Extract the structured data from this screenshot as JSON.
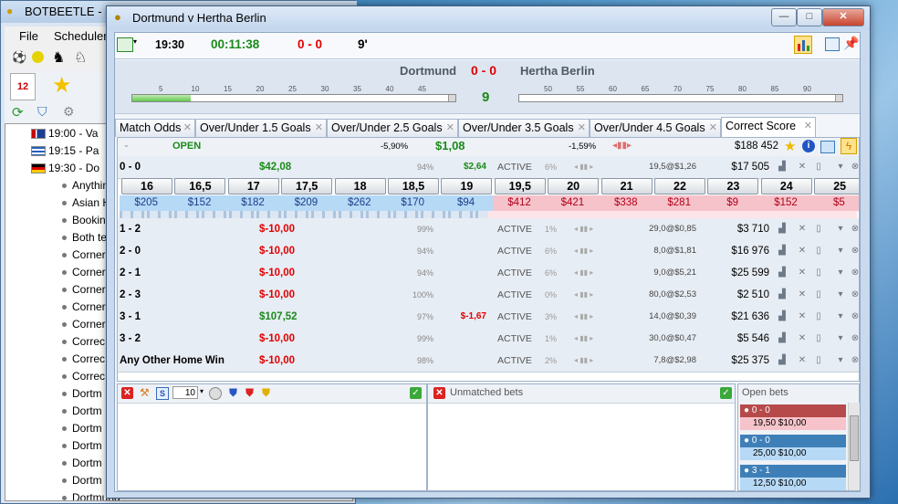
{
  "background_app": {
    "title": "BOTBEETLE - 5.4",
    "menu": [
      "File",
      "Schedulers"
    ],
    "tree_rows": [
      {
        "text": "19:00 - Va",
        "flag": "gb"
      },
      {
        "text": "19:15 - Pa",
        "flag": "gr"
      },
      {
        "text": "19:30 - Do",
        "flag": "de"
      }
    ],
    "tree_items": [
      "Anythin",
      "Asian H",
      "Bookin",
      "Both te",
      "Corner",
      "Corner",
      "Corner",
      "Corner",
      "Corner",
      "Correc",
      "Correc",
      "Correc",
      "Dortm",
      "Dortm",
      "Dortm",
      "Dortm",
      "Dortm",
      "Dortm",
      "Dortmund"
    ]
  },
  "window": {
    "title": "Dortmund v Hertha Berlin",
    "min": "—",
    "max": "□",
    "close": "✕"
  },
  "info_bar": {
    "kickoff": "19:30",
    "elapsed": "00:11:38",
    "score": "0 - 0",
    "minute": "9'"
  },
  "match": {
    "home": "Dortmund",
    "away": "Hertha Berlin",
    "score": "0 - 0",
    "minute": "9",
    "home_progress": 0.18,
    "first_half_ticks": [
      "5",
      "10",
      "15",
      "20",
      "25",
      "30",
      "35",
      "40",
      "45"
    ],
    "second_half_ticks": [
      "50",
      "55",
      "60",
      "65",
      "70",
      "75",
      "80",
      "85",
      "90"
    ]
  },
  "tabs": [
    {
      "label": "Match Odds",
      "active": false
    },
    {
      "label": "Over/Under 1.5 Goals",
      "active": false
    },
    {
      "label": "Over/Under 2.5 Goals",
      "active": false
    },
    {
      "label": "Over/Under 3.5 Goals",
      "active": false
    },
    {
      "label": "Over/Under 4.5 Goals",
      "active": false
    },
    {
      "label": "Correct Score",
      "active": true
    }
  ],
  "market_header": {
    "status": "OPEN",
    "book_pct": "-5,90%",
    "book_value": "$1,08",
    "book_pct2": "-1,59%",
    "matched_total": "$188 452"
  },
  "ladder": {
    "prices": [
      "16",
      "16,5",
      "17",
      "17,5",
      "18",
      "18,5",
      "19",
      "19,5",
      "20",
      "21",
      "22",
      "23",
      "24",
      "25"
    ],
    "amounts": [
      "$205",
      "$152",
      "$182",
      "$209",
      "$262",
      "$170",
      "$94",
      "$412",
      "$421",
      "$338",
      "$281",
      "$9",
      "$152",
      "$5"
    ],
    "back_count": 7
  },
  "selections": [
    {
      "name": "0 - 0",
      "pl": "$42,08",
      "pl_color": "green",
      "pct": "94%",
      "pl2": "$2,64",
      "pl2_color": "green",
      "status": "ACTIVE",
      "spread": "6%",
      "last": "19,5@$1,26",
      "volume": "$17 505"
    },
    {
      "name": "1 - 2",
      "pl": "$-10,00",
      "pl_color": "red",
      "pct": "99%",
      "pl2": "",
      "pl2_color": "",
      "status": "ACTIVE",
      "spread": "1%",
      "last": "29,0@$0,85",
      "volume": "$3 710"
    },
    {
      "name": "2 - 0",
      "pl": "$-10,00",
      "pl_color": "red",
      "pct": "94%",
      "pl2": "",
      "pl2_color": "",
      "status": "ACTIVE",
      "spread": "6%",
      "last": "8,0@$1,81",
      "volume": "$16 976"
    },
    {
      "name": "2 - 1",
      "pl": "$-10,00",
      "pl_color": "red",
      "pct": "94%",
      "pl2": "",
      "pl2_color": "",
      "status": "ACTIVE",
      "spread": "6%",
      "last": "9,0@$5,21",
      "volume": "$25 599"
    },
    {
      "name": "2 - 3",
      "pl": "$-10,00",
      "pl_color": "red",
      "pct": "100%",
      "pl2": "",
      "pl2_color": "",
      "status": "ACTIVE",
      "spread": "0%",
      "last": "80,0@$2,53",
      "volume": "$2 510"
    },
    {
      "name": "3 - 1",
      "pl": "$107,52",
      "pl_color": "green",
      "pct": "97%",
      "pl2": "$-1,67",
      "pl2_color": "red",
      "status": "ACTIVE",
      "spread": "3%",
      "last": "14,0@$0,39",
      "volume": "$21 636"
    },
    {
      "name": "3 - 2",
      "pl": "$-10,00",
      "pl_color": "red",
      "pct": "99%",
      "pl2": "",
      "pl2_color": "",
      "status": "ACTIVE",
      "spread": "1%",
      "last": "30,0@$0,47",
      "volume": "$5 546"
    },
    {
      "name": "Any Other Home Win",
      "pl": "$-10,00",
      "pl_color": "red",
      "pct": "98%",
      "pl2": "",
      "pl2_color": "",
      "status": "ACTIVE",
      "spread": "2%",
      "last": "7,8@$2,98",
      "volume": "$25 375"
    }
  ],
  "bottom": {
    "stake_value": "10",
    "unmatched_label": "Unmatched bets",
    "open_bets_label": "Open bets",
    "open_bets": [
      {
        "selection": "0 - 0",
        "detail": "19,50   $10,00",
        "type": "lay"
      },
      {
        "selection": "0 - 0",
        "detail": "25,00   $10,00",
        "type": "back"
      },
      {
        "selection": "3 - 1",
        "detail": "12,50   $10,00",
        "type": "back"
      }
    ]
  },
  "colors": {
    "back": "#b6d9f6",
    "lay": "#f7c3ca",
    "green": "#1a8a1a",
    "red": "#e00000"
  }
}
